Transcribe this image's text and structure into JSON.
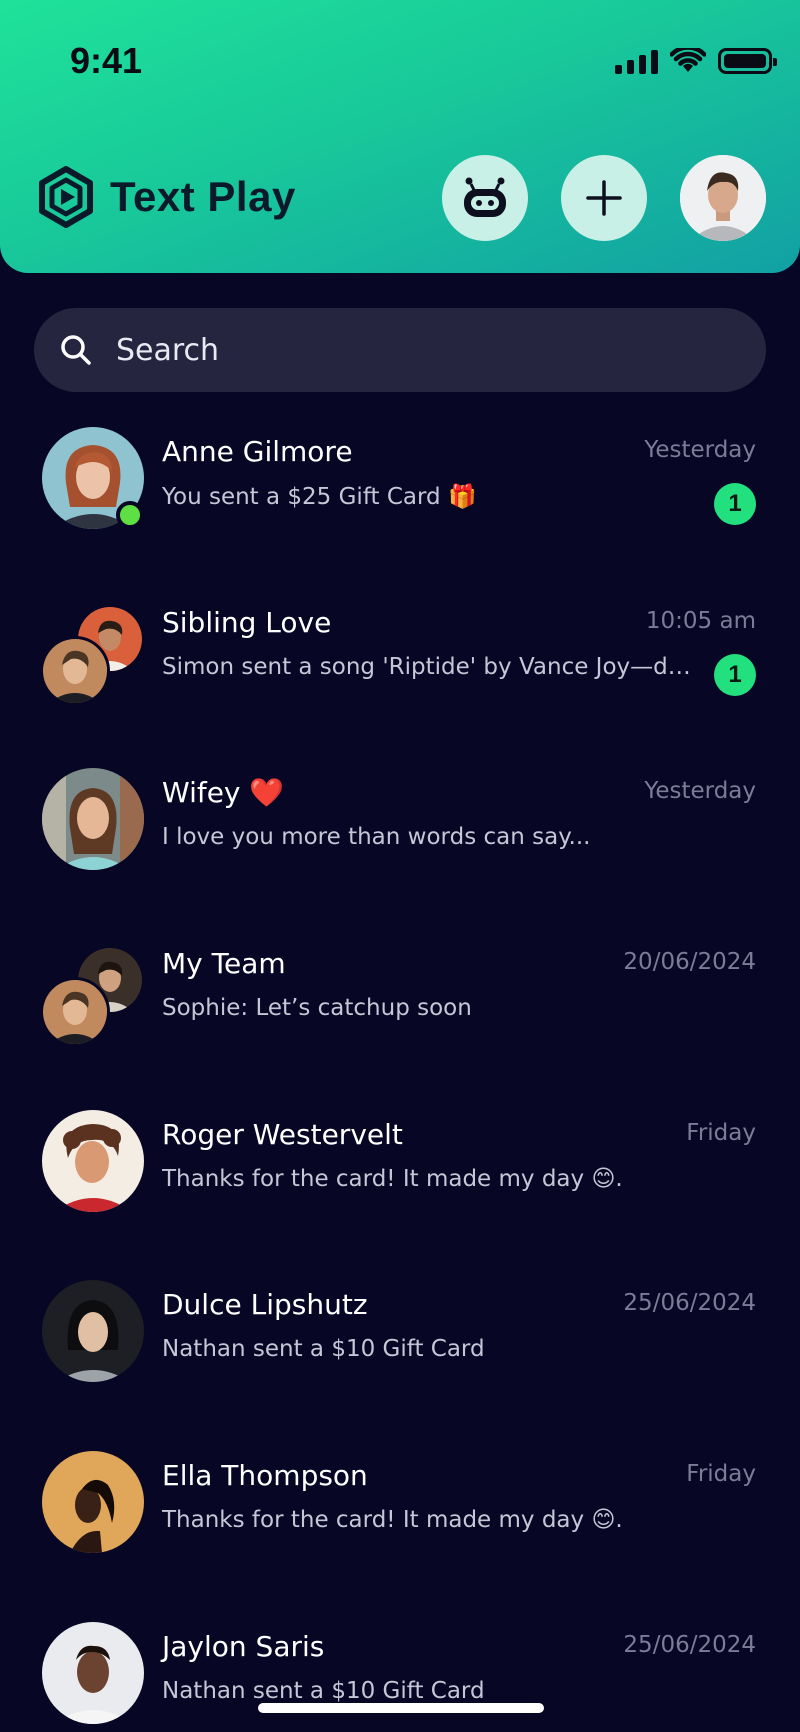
{
  "status_bar": {
    "time": "9:41"
  },
  "header": {
    "app_title": "Text Play"
  },
  "search": {
    "placeholder": "Search"
  },
  "conversations": [
    {
      "name": "Anne Gilmore",
      "time": "Yesterday",
      "preview": "You sent a $25 Gift Card 🎁",
      "unread": "1"
    },
    {
      "name": "Sibling Love",
      "time": "10:05 am",
      "preview": "Simon sent a song 'Riptide' by Vance Joy—de...",
      "unread": "1"
    },
    {
      "name": "Wifey ❤️",
      "time": "Yesterday",
      "preview": "I love you more than words can say..."
    },
    {
      "name": "My Team",
      "time": "20/06/2024",
      "preview": "Sophie: Let’s catchup soon"
    },
    {
      "name": "Roger Westervelt",
      "time": "Friday",
      "preview": "Thanks for the card! It made my day 😊."
    },
    {
      "name": "Dulce Lipshutz",
      "time": "25/06/2024",
      "preview": "Nathan sent a $10 Gift Card"
    },
    {
      "name": "Ella Thompson",
      "time": "Friday",
      "preview": "Thanks for the card! It made my day 😊."
    },
    {
      "name": "Jaylon Saris",
      "time": "25/06/2024",
      "preview": "Nathan sent a $10 Gift Card"
    }
  ],
  "colors": {
    "background": "#070625",
    "header_gradient_start": "#1fe29a",
    "header_gradient_end": "#12a0a4",
    "unread_badge": "#22e07e",
    "online_status": "#5ee044",
    "search_bg": "#262540"
  },
  "icons": [
    "logo-icon",
    "robot-icon",
    "plus-icon",
    "search-icon",
    "signal-icon",
    "wifi-icon",
    "battery-icon"
  ]
}
